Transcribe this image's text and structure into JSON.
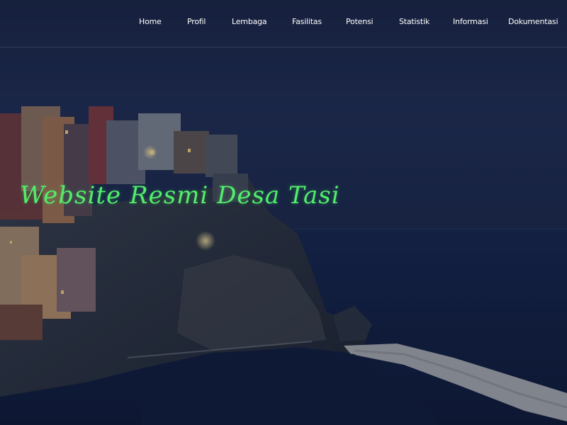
{
  "colors": {
    "title": "#52ee6a",
    "nav_text": "#ffffff",
    "sky": "#1e2a4d",
    "sea": "#111d3c"
  },
  "navbar": {
    "items": [
      {
        "label": "Home"
      },
      {
        "label": "Profil"
      },
      {
        "label": "Lembaga"
      },
      {
        "label": "Fasilitas"
      },
      {
        "label": "Potensi"
      },
      {
        "label": "Statistik"
      },
      {
        "label": "Informasi"
      },
      {
        "label": "Dokumentasi"
      }
    ]
  },
  "hero": {
    "title": "Website Resmi Desa Tasi",
    "background_icon": "coastal-village-night-photo"
  }
}
